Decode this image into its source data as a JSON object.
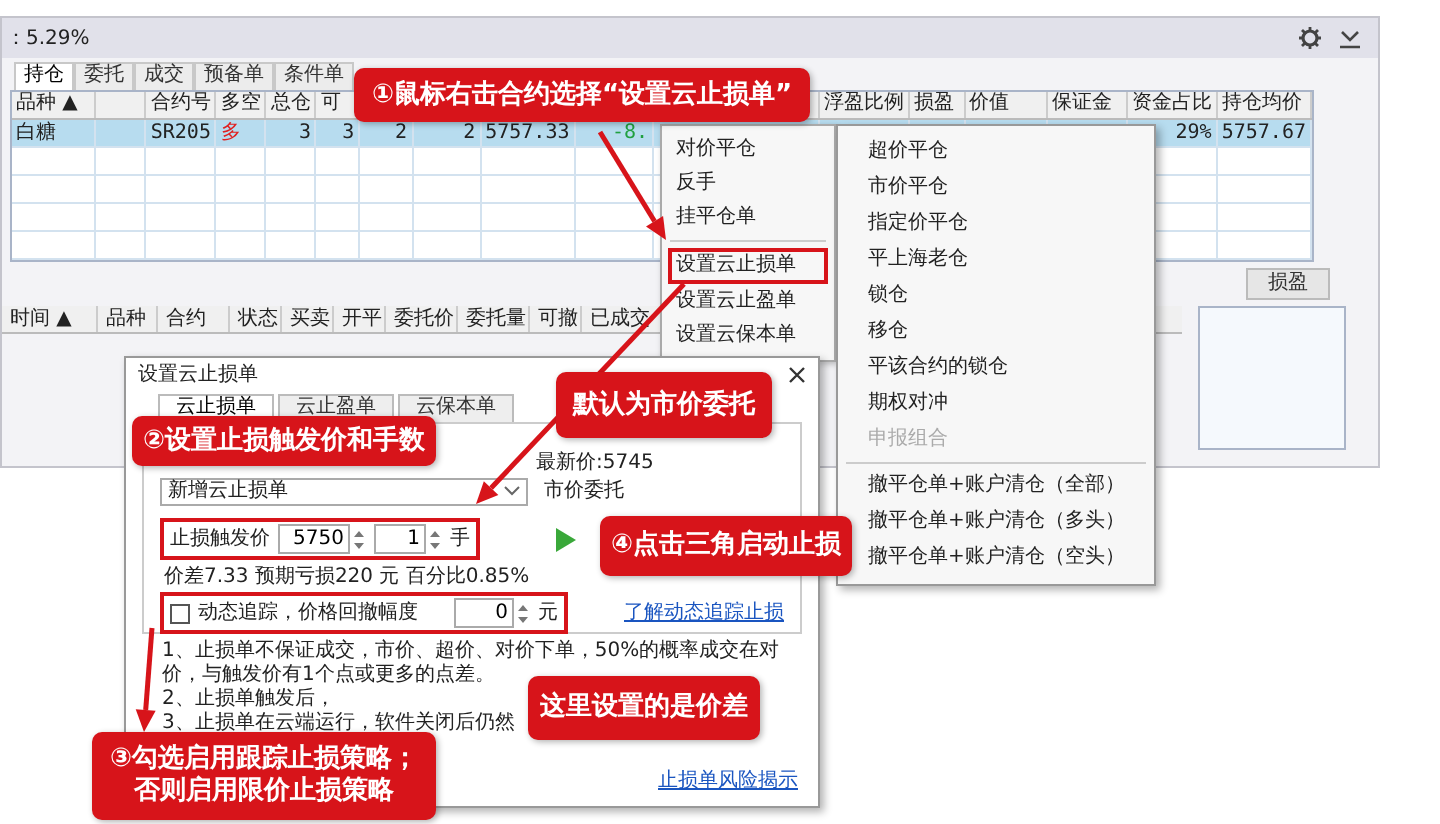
{
  "window": {
    "title": "：5.29%"
  },
  "position_tabs": [
    {
      "label": "持仓",
      "selected": true
    },
    {
      "label": "委托",
      "selected": false
    },
    {
      "label": "成交",
      "selected": false
    },
    {
      "label": "预备单",
      "selected": false
    },
    {
      "label": "条件单",
      "selected": false
    }
  ],
  "positions_table": {
    "columns": [
      {
        "label": "品种 ▲"
      },
      {},
      {
        "label": "合约号"
      },
      {
        "label": "多空"
      },
      {
        "label": "总仓"
      },
      {
        "label": "可"
      },
      {},
      {},
      {},
      {},
      {},
      {
        "label": "浮盈比例"
      },
      {
        "label": "损盈"
      },
      {
        "label": "价值"
      },
      {
        "label": "保证金"
      },
      {
        "label": "资金占比"
      },
      {
        "label": "持仓均价"
      }
    ],
    "rows": [
      {
        "selected": true,
        "cells": [
          {
            "text": "白糖"
          },
          {},
          {
            "text": "SR205"
          },
          {
            "text": "多",
            "color": "#e02020"
          },
          {
            "text": "3"
          },
          {
            "text": "3"
          },
          {
            "text": "2"
          },
          {
            "text": "2"
          },
          {
            "text": "5757.33"
          },
          {
            "text": "-8.",
            "color": "#20a040"
          },
          {},
          {},
          {},
          {},
          {},
          {
            "text": "29%"
          },
          {
            "text": "5757.67"
          }
        ]
      }
    ]
  },
  "side_buttons": [
    {
      "label": "损盈"
    }
  ],
  "orders_table": {
    "columns": [
      "时间 ▲",
      "品种",
      "合约",
      "状态",
      "买卖",
      "开平",
      "委托价",
      "委托量",
      "可撤",
      "已成交"
    ]
  },
  "context_menu": {
    "groups": [
      [
        {
          "label": "对价平仓",
          "highlighted": false
        },
        {
          "label": "反手",
          "highlighted": false
        },
        {
          "label": "挂平仓单",
          "highlighted": false
        }
      ],
      [
        {
          "label": "设置云止损单",
          "highlighted": true
        },
        {
          "label": "设置云止盈单",
          "highlighted": false
        },
        {
          "label": "设置云保本单",
          "highlighted": false
        }
      ]
    ]
  },
  "submenu": {
    "groups": [
      [
        {
          "label": "超价平仓",
          "disabled": false
        },
        {
          "label": "市价平仓",
          "disabled": false
        },
        {
          "label": "指定价平仓",
          "disabled": false
        },
        {
          "label": "平上海老仓",
          "disabled": false
        },
        {
          "label": "锁仓",
          "disabled": false
        },
        {
          "label": "移仓",
          "disabled": false
        },
        {
          "label": "平该合约的锁仓",
          "disabled": false
        },
        {
          "label": "期权对冲",
          "disabled": false
        },
        {
          "label": "申报组合",
          "disabled": true
        }
      ],
      [
        {
          "label": "撤平仓单+账户清仓（全部）",
          "disabled": false
        },
        {
          "label": "撤平仓单+账户清仓（多头）",
          "disabled": false
        },
        {
          "label": "撤平仓单+账户清仓（空头）",
          "disabled": false
        }
      ]
    ]
  },
  "dialog": {
    "title": "设置云止损单",
    "tabs": [
      {
        "label": "云止损单",
        "selected": true
      },
      {
        "label": "云止盈单",
        "selected": false
      },
      {
        "label": "云保本单",
        "selected": false
      }
    ],
    "last_price": "最新价:5745",
    "order_select": {
      "value": "新增云止损单"
    },
    "order_type": "市价委托",
    "trigger_label": "止损触发价",
    "trigger_price": "5750",
    "lots": "1",
    "lots_unit": "手",
    "summary": "价差7.33 预期亏损220 元 百分比0.85%",
    "trailing": {
      "checked": false,
      "label": "动态追踪，价格回撤幅度",
      "value": "0",
      "unit": "元"
    },
    "trailing_link": "了解动态追踪止损",
    "notes": [
      "1、止损单不保证成交，市价、超价、对价下单，50%的概率成交在对价，与触发价有1个点或更多的点差。",
      "2、止损单触发后，",
      "3、止损单在云端运行，软件关闭后仍然"
    ],
    "risk_link": "止损单风险揭示"
  },
  "callouts": [
    {
      "text": "①鼠标右击合约选择“设置云止损单”"
    },
    {
      "text": "默认为市价委托"
    },
    {
      "text": "②设置止损触发价和手数"
    },
    {
      "text": "④点击三角启动止损"
    },
    {
      "text": "这里设置的是价差"
    },
    {
      "text": "③勾选启用跟踪止损策略；否则启用限价止损策略"
    }
  ]
}
